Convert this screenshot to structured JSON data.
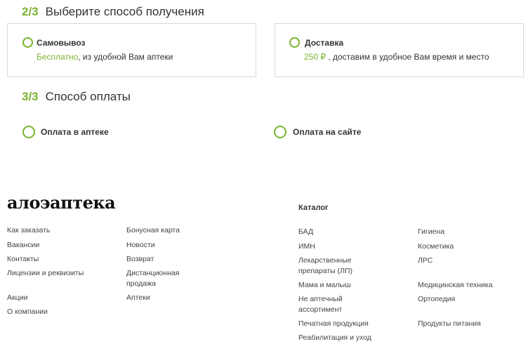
{
  "step2": {
    "number": "2/3",
    "title": "Выберите способ получения"
  },
  "pickup": {
    "title": "Самовывоз",
    "price": "Бесплатно",
    "desc": ", из удобной Вам аптеки"
  },
  "delivery": {
    "title": "Доставка",
    "price": "250 ₽",
    "desc": " , доставим в удобное Вам время и место"
  },
  "step3": {
    "number": "3/3",
    "title": "Способ оплаты"
  },
  "payment": {
    "in_pharmacy": "Оплата в аптеке",
    "online": "Оплата на сайте"
  },
  "footer": {
    "logo": "алоэаптека",
    "col1": [
      "Как заказать",
      "Вакансии",
      "Контакты",
      "Лицензии и реквизиты",
      "Акции",
      "О компании"
    ],
    "col2": [
      "Бонусная карта",
      "Новости",
      "Возврат",
      "Дистанционная продажа",
      "Аптеки"
    ],
    "catalog_heading": "Каталог",
    "catalog_col1": [
      "БАД",
      "ИМН",
      "Лекарственные препараты (ЛП)",
      "Мама и малыш",
      "Не аптечный ассортимент",
      "Печатная продукция",
      "Реабилитация и уход"
    ],
    "catalog_col2": [
      "Гигиена",
      "Косметика",
      "ЛРС",
      "Медицинская техника",
      "Ортопедия",
      "Продукты питания"
    ]
  },
  "colors": {
    "accent": "#7ab32e",
    "border": "#d9d9d9",
    "text": "#333333"
  }
}
